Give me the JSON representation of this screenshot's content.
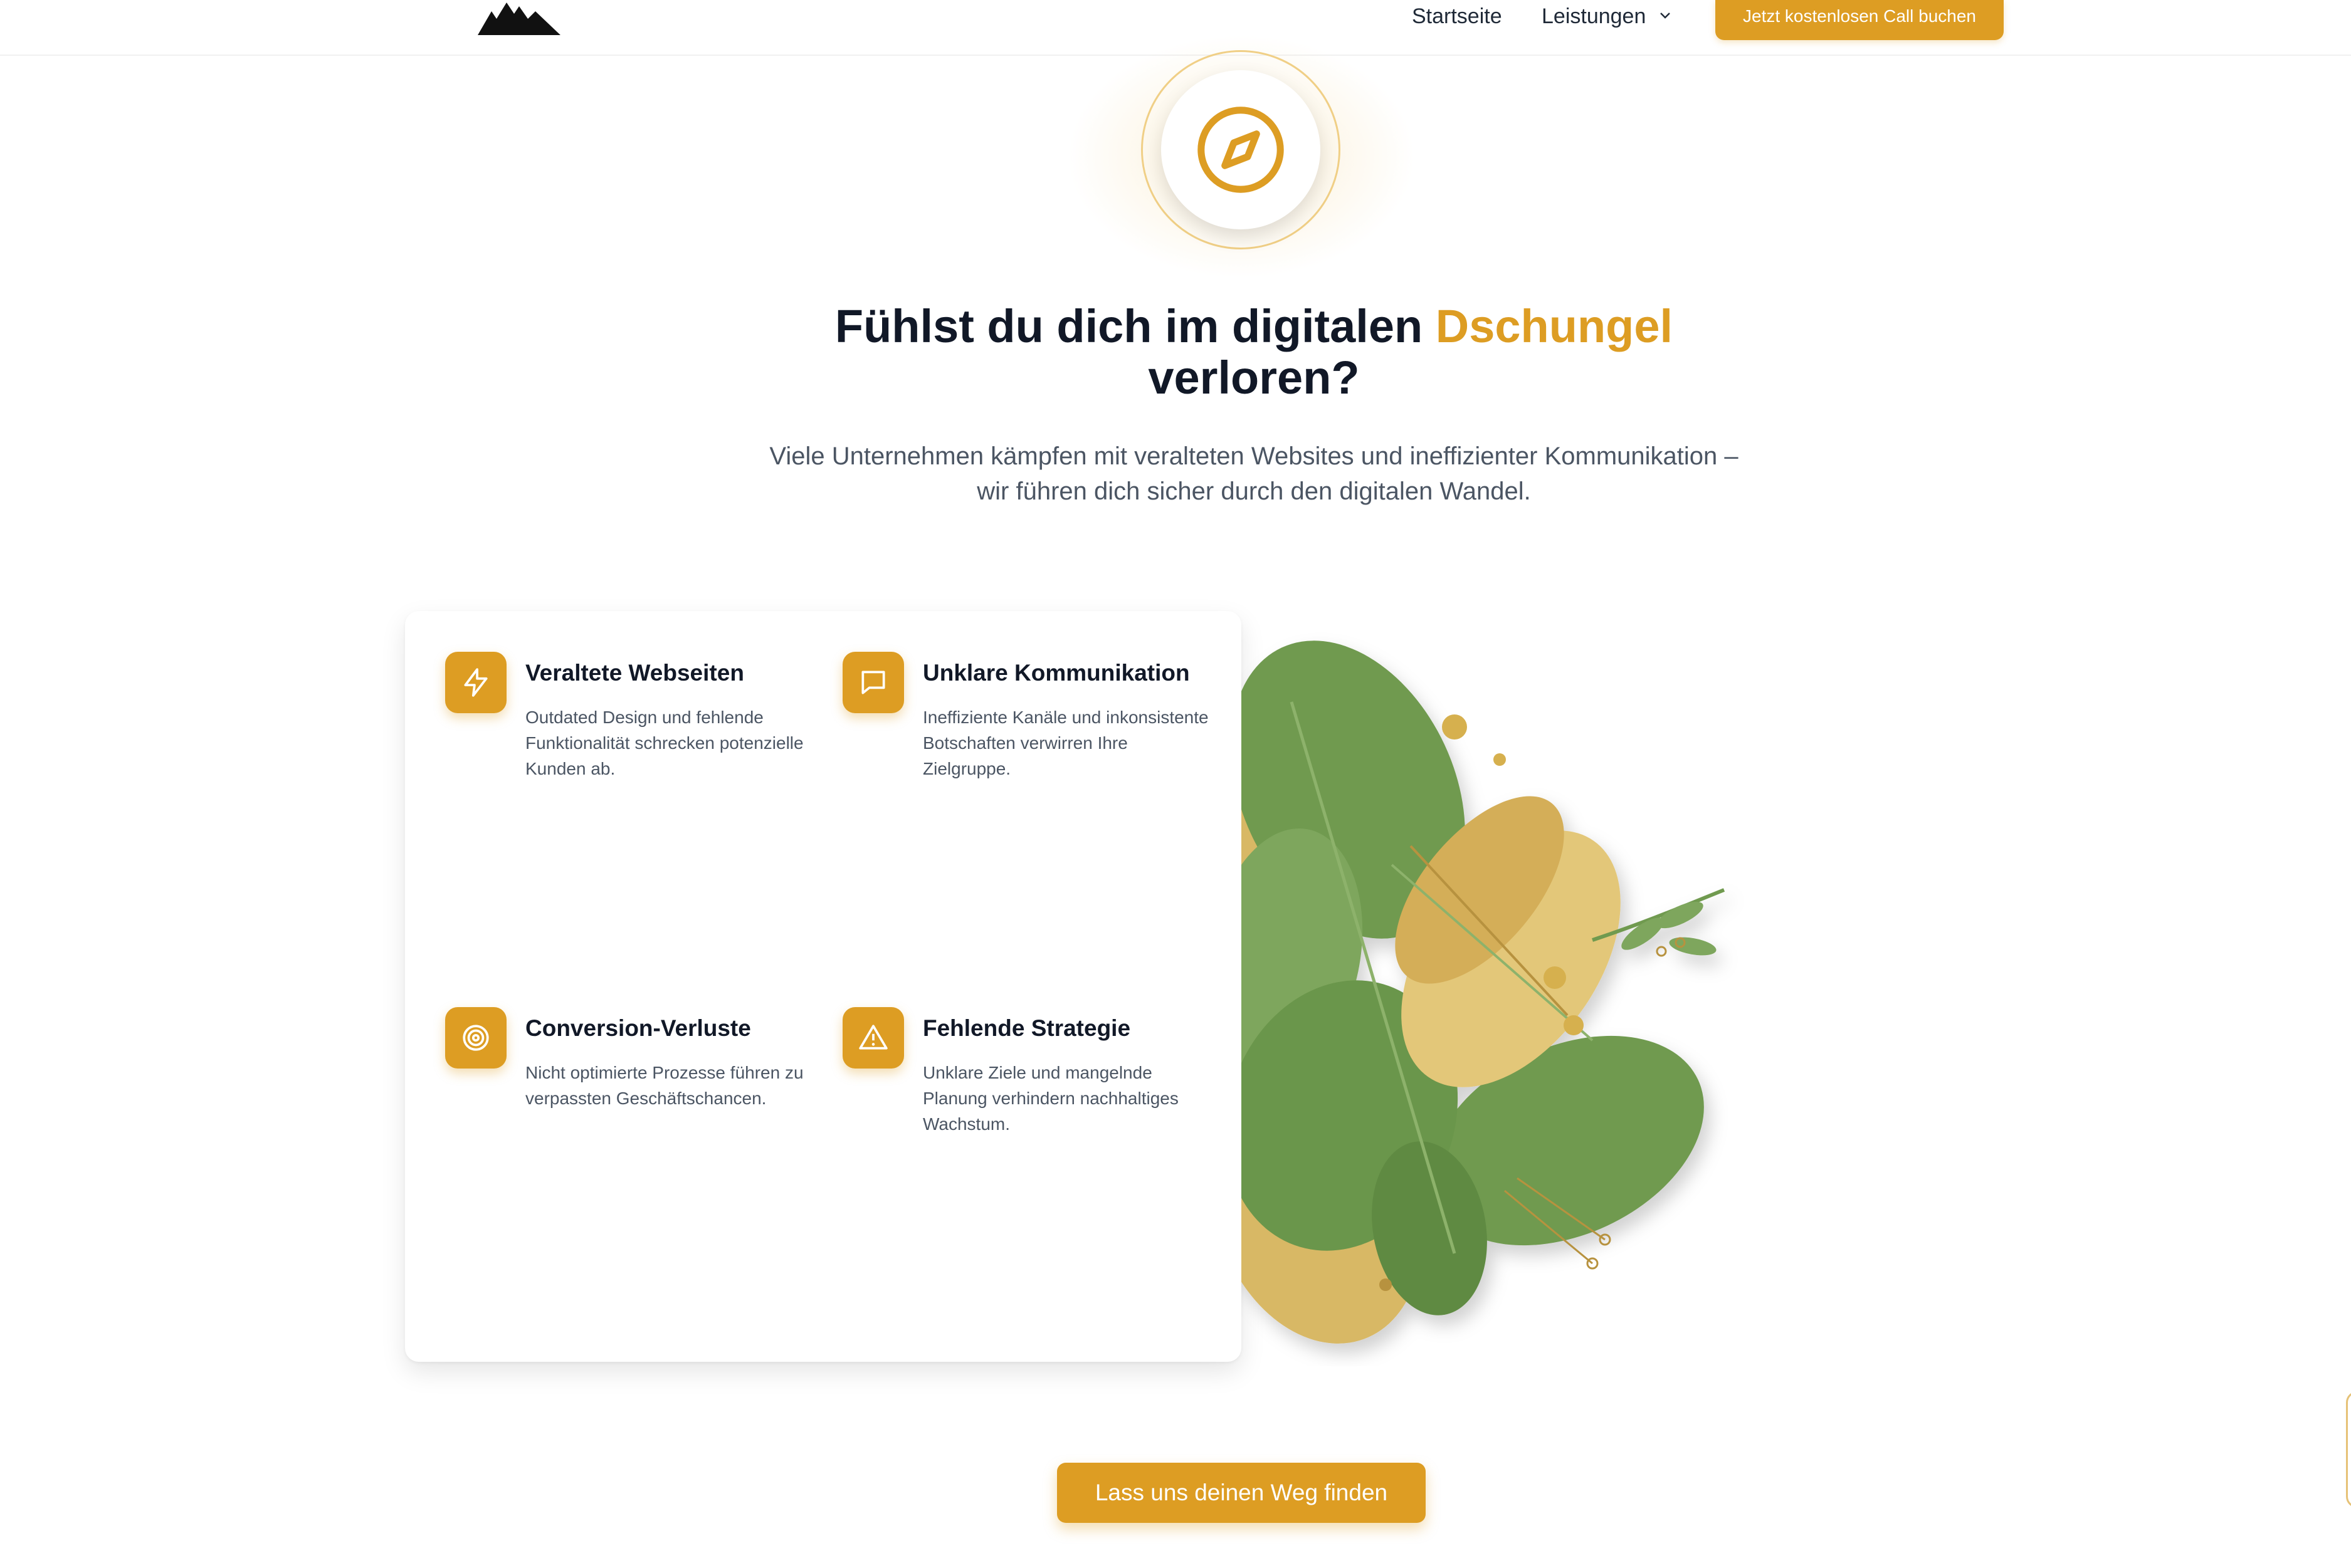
{
  "nav": {
    "logo_icon": "mountain-logo-icon",
    "links": [
      "Startseite",
      "Leistungen"
    ],
    "dropdown_icon": "chevron-down-icon",
    "cta_label": "Jetzt kostenlosen Call buchen"
  },
  "hero": {
    "badge_icon": "compass-icon",
    "title_part1": "Fühlst du dich im digitalen ",
    "title_accent": "Dschungel",
    "title_part2": "verloren?",
    "subtitle_line1": "Viele Unternehmen kämpfen mit veralteten Websites und ineffizienter Kommunikation –",
    "subtitle_line2": "wir führen dich sicher durch den digitalen Wandel."
  },
  "features": [
    {
      "icon": "lightning-icon",
      "title": "Veraltete Webseiten",
      "description": "Outdated Design und fehlende Funktionalität schrecken potenzielle Kunden ab."
    },
    {
      "icon": "chat-bubble-icon",
      "title": "Unklare Kommunikation",
      "description": "Ineffiziente Kanäle und inkonsistente Botschaften verwirren Ihre Zielgruppe."
    },
    {
      "icon": "target-icon",
      "title": "Conversion-Verluste",
      "description": "Nicht optimierte Prozesse führen zu verpassten Geschäftschancen."
    },
    {
      "icon": "warning-triangle-icon",
      "title": "Fehlende Strategie",
      "description": "Unklare Ziele und mangelnde Planung verhindern nachhaltiges Wachstum."
    }
  ],
  "cta": {
    "label": "Lass uns deinen Weg finden"
  },
  "colors": {
    "accent": "#dd9d23",
    "text": "#111827",
    "muted": "#4b5563",
    "leaf_green": "#6f9a4f",
    "leaf_gold": "#d9b65f"
  }
}
